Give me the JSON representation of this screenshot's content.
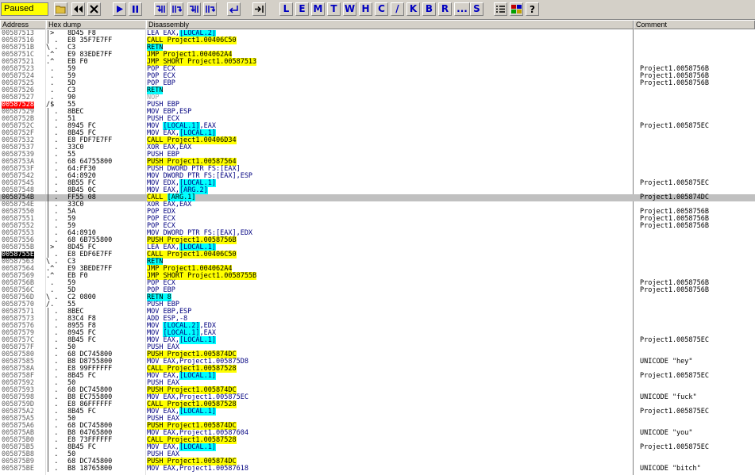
{
  "status": "Paused",
  "toolbar_letters": [
    "L",
    "E",
    "M",
    "T",
    "W",
    "H",
    "C",
    "/",
    "K",
    "B",
    "R",
    "...",
    "S"
  ],
  "columns": {
    "address": "Address",
    "hex": "Hex dump",
    "disasm": "Disassembly",
    "comment": "Comment"
  },
  "rows": [
    {
      "addr": "00587513",
      "mark": "|>",
      "hex": "8D45 F8",
      "dis": "LEA EAX,[LOCAL.2]",
      "com": ""
    },
    {
      "addr": "00587516",
      "mark": "| .",
      "hex": "E8 35F7E7FF",
      "dis": "CALL Project1.00406C50",
      "com": ""
    },
    {
      "addr": "0058751B",
      "mark": "\\ .",
      "hex": "C3",
      "dis": "RETN",
      "com": ""
    },
    {
      "addr": "0058751C",
      "mark": ".^",
      "hex": "E9 83EDE7FF",
      "dis": "JMP Project1.004062A4",
      "com": ""
    },
    {
      "addr": "00587521",
      "mark": ".^",
      "hex": "EB F0",
      "dis": "JMP SHORT Project1.00587513",
      "com": ""
    },
    {
      "addr": "00587523",
      "mark": " .",
      "hex": "59",
      "dis": "POP ECX",
      "com": "Project1.0058756B"
    },
    {
      "addr": "00587524",
      "mark": " .",
      "hex": "59",
      "dis": "POP ECX",
      "com": "Project1.0058756B"
    },
    {
      "addr": "00587525",
      "mark": " .",
      "hex": "5D",
      "dis": "POP EBP",
      "com": "Project1.0058756B"
    },
    {
      "addr": "00587526",
      "mark": " .",
      "hex": "C3",
      "dis": "RETN",
      "com": ""
    },
    {
      "addr": "00587527",
      "mark": " .",
      "hex": "90",
      "dis": "NOP",
      "com": ""
    },
    {
      "addr": "00587528",
      "mark": "/$",
      "hex": "55",
      "dis": "PUSH EBP",
      "com": ""
    },
    {
      "addr": "00587529",
      "mark": "| .",
      "hex": "8BEC",
      "dis": "MOV EBP,ESP",
      "com": ""
    },
    {
      "addr": "0058752B",
      "mark": "| .",
      "hex": "51",
      "dis": "PUSH ECX",
      "com": ""
    },
    {
      "addr": "0058752C",
      "mark": "| .",
      "hex": "8945 FC",
      "dis": "MOV [LOCAL.1],EAX",
      "com": "Project1.005875EC"
    },
    {
      "addr": "0058752F",
      "mark": "| .",
      "hex": "8B45 FC",
      "dis": "MOV EAX,[LOCAL.1]",
      "com": ""
    },
    {
      "addr": "00587532",
      "mark": "| .",
      "hex": "E8 FDF7E7FF",
      "dis": "CALL Project1.00406D34",
      "com": ""
    },
    {
      "addr": "00587537",
      "mark": "| .",
      "hex": "33C0",
      "dis": "XOR EAX,EAX",
      "com": ""
    },
    {
      "addr": "00587539",
      "mark": "| .",
      "hex": "55",
      "dis": "PUSH EBP",
      "com": ""
    },
    {
      "addr": "0058753A",
      "mark": "| .",
      "hex": "68 64755800",
      "dis": "PUSH Project1.00587564",
      "com": ""
    },
    {
      "addr": "0058753F",
      "mark": "| .",
      "hex": "64:FF30",
      "dis": "PUSH DWORD PTR FS:[EAX]",
      "com": ""
    },
    {
      "addr": "00587542",
      "mark": "| .",
      "hex": "64:8920",
      "dis": "MOV DWORD PTR FS:[EAX],ESP",
      "com": ""
    },
    {
      "addr": "00587545",
      "mark": "| .",
      "hex": "8B55 FC",
      "dis": "MOV EDX,[LOCAL.1]",
      "com": "Project1.005875EC"
    },
    {
      "addr": "00587548",
      "mark": "| .",
      "hex": "8B45 0C",
      "dis": "MOV EAX,[ARG.2]",
      "com": ""
    },
    {
      "addr": "0058754B",
      "mark": "| .",
      "hex": "FF55 08",
      "dis": "CALL [ARG.1]",
      "com": "Project1.005874DC"
    },
    {
      "addr": "0058754E",
      "mark": "| .",
      "hex": "33C0",
      "dis": "XOR EAX,EAX",
      "com": ""
    },
    {
      "addr": "00587550",
      "mark": "| .",
      "hex": "5A",
      "dis": "POP EDX",
      "com": "Project1.0058756B"
    },
    {
      "addr": "00587551",
      "mark": "| .",
      "hex": "59",
      "dis": "POP ECX",
      "com": "Project1.0058756B"
    },
    {
      "addr": "00587552",
      "mark": "| .",
      "hex": "59",
      "dis": "POP ECX",
      "com": "Project1.0058756B"
    },
    {
      "addr": "00587553",
      "mark": "| .",
      "hex": "64:8910",
      "dis": "MOV DWORD PTR FS:[EAX],EDX",
      "com": ""
    },
    {
      "addr": "00587556",
      "mark": "| .",
      "hex": "68 6B755800",
      "dis": "PUSH Project1.0058756B",
      "com": ""
    },
    {
      "addr": "0058755B",
      "mark": "|>",
      "hex": "8D45 FC",
      "dis": "LEA EAX,[LOCAL.1]",
      "com": ""
    },
    {
      "addr": "0058755E",
      "mark": "| .",
      "hex": "E8 EDF6E7FF",
      "dis": "CALL Project1.00406C50",
      "com": ""
    },
    {
      "addr": "00587563",
      "mark": "\\ .",
      "hex": "C3",
      "dis": "RETN",
      "com": ""
    },
    {
      "addr": "00587564",
      "mark": ".^",
      "hex": "E9 3BEDE7FF",
      "dis": "JMP Project1.004062A4",
      "com": ""
    },
    {
      "addr": "00587569",
      "mark": ".^",
      "hex": "EB F0",
      "dis": "JMP SHORT Project1.0058755B",
      "com": ""
    },
    {
      "addr": "0058756B",
      "mark": " .",
      "hex": "59",
      "dis": "POP ECX",
      "com": "Project1.0058756B"
    },
    {
      "addr": "0058756C",
      "mark": " .",
      "hex": "5D",
      "dis": "POP EBP",
      "com": "Project1.0058756B"
    },
    {
      "addr": "0058756D",
      "mark": "\\ .",
      "hex": "C2 0800",
      "dis": "RETN 8",
      "com": ""
    },
    {
      "addr": "00587570",
      "mark": "/.",
      "hex": "55",
      "dis": "PUSH EBP",
      "com": ""
    },
    {
      "addr": "00587571",
      "mark": "| .",
      "hex": "8BEC",
      "dis": "MOV EBP,ESP",
      "com": ""
    },
    {
      "addr": "00587573",
      "mark": "| .",
      "hex": "83C4 F8",
      "dis": "ADD ESP,-8",
      "com": ""
    },
    {
      "addr": "00587576",
      "mark": "| .",
      "hex": "8955 F8",
      "dis": "MOV [LOCAL.2],EDX",
      "com": ""
    },
    {
      "addr": "00587579",
      "mark": "| .",
      "hex": "8945 FC",
      "dis": "MOV [LOCAL.1],EAX",
      "com": ""
    },
    {
      "addr": "0058757C",
      "mark": "| .",
      "hex": "8B45 FC",
      "dis": "MOV EAX,[LOCAL.1]",
      "com": "Project1.005875EC"
    },
    {
      "addr": "0058757F",
      "mark": "| .",
      "hex": "50",
      "dis": "PUSH EAX",
      "com": ""
    },
    {
      "addr": "00587580",
      "mark": "| .",
      "hex": "68 DC745800",
      "dis": "PUSH Project1.005874DC",
      "com": ""
    },
    {
      "addr": "00587585",
      "mark": "| .",
      "hex": "B8 D8755800",
      "dis": "MOV EAX,Project1.005875D8",
      "com": "UNICODE \"hey\""
    },
    {
      "addr": "0058758A",
      "mark": "| .",
      "hex": "E8 99FFFFFF",
      "dis": "CALL Project1.00587528",
      "com": ""
    },
    {
      "addr": "0058758F",
      "mark": "| .",
      "hex": "8B45 FC",
      "dis": "MOV EAX,[LOCAL.1]",
      "com": "Project1.005875EC"
    },
    {
      "addr": "00587592",
      "mark": "| .",
      "hex": "50",
      "dis": "PUSH EAX",
      "com": ""
    },
    {
      "addr": "00587593",
      "mark": "| .",
      "hex": "68 DC745800",
      "dis": "PUSH Project1.005874DC",
      "com": ""
    },
    {
      "addr": "00587598",
      "mark": "| .",
      "hex": "B8 EC755800",
      "dis": "MOV EAX,Project1.005875EC",
      "com": "UNICODE \"fuck\""
    },
    {
      "addr": "0058759D",
      "mark": "| .",
      "hex": "E8 86FFFFFF",
      "dis": "CALL Project1.00587528",
      "com": ""
    },
    {
      "addr": "005875A2",
      "mark": "| .",
      "hex": "8B45 FC",
      "dis": "MOV EAX,[LOCAL.1]",
      "com": "Project1.005875EC"
    },
    {
      "addr": "005875A5",
      "mark": "| .",
      "hex": "50",
      "dis": "PUSH EAX",
      "com": ""
    },
    {
      "addr": "005875A6",
      "mark": "| .",
      "hex": "68 DC745800",
      "dis": "PUSH Project1.005874DC",
      "com": ""
    },
    {
      "addr": "005875AB",
      "mark": "| .",
      "hex": "B8 04765800",
      "dis": "MOV EAX,Project1.00587604",
      "com": "UNICODE \"you\""
    },
    {
      "addr": "005875B0",
      "mark": "| .",
      "hex": "E8 73FFFFFF",
      "dis": "CALL Project1.00587528",
      "com": ""
    },
    {
      "addr": "005875B5",
      "mark": "| .",
      "hex": "8B45 FC",
      "dis": "MOV EAX,[LOCAL.1]",
      "com": "Project1.005875EC"
    },
    {
      "addr": "005875B8",
      "mark": "| .",
      "hex": "50",
      "dis": "PUSH EAX",
      "com": ""
    },
    {
      "addr": "005875B9",
      "mark": "| .",
      "hex": "68 DC745800",
      "dis": "PUSH Project1.005874DC",
      "com": ""
    },
    {
      "addr": "005875BE",
      "mark": "| .",
      "hex": "B8 18765800",
      "dis": "MOV EAX,Project1.00587618",
      "com": "UNICODE \"bitch\""
    }
  ]
}
